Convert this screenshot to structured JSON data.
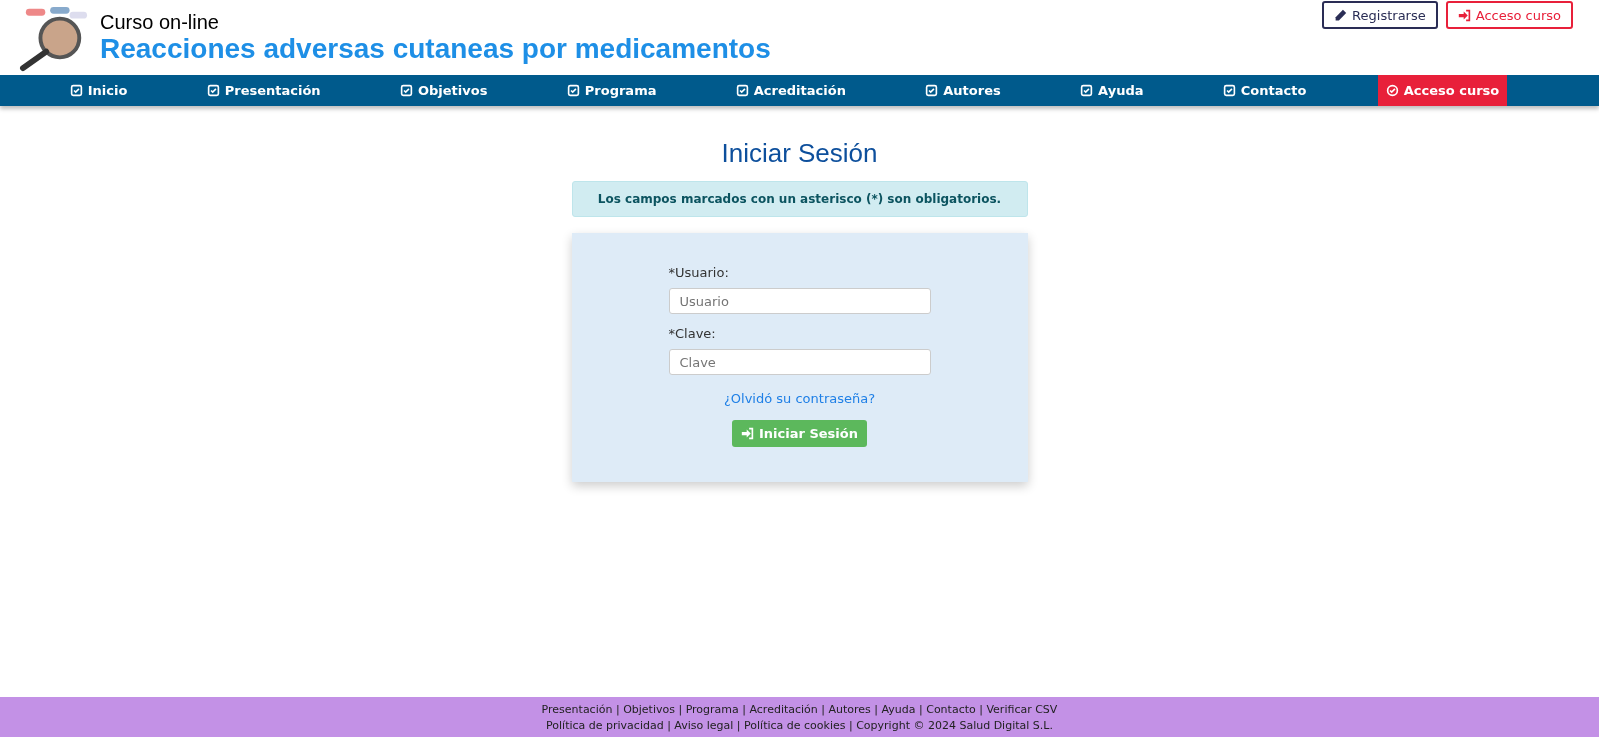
{
  "header": {
    "subtitle": "Curso on-line",
    "title": "Reacciones adversas cutaneas por medicamentos",
    "buttons": [
      {
        "label": "Registrarse",
        "kind": "register"
      },
      {
        "label": "Acceso curso",
        "kind": "access"
      }
    ]
  },
  "nav": [
    {
      "label": "Inicio",
      "selected": false
    },
    {
      "label": "Presentación",
      "selected": false
    },
    {
      "label": "Objetivos",
      "selected": false
    },
    {
      "label": "Programa",
      "selected": false
    },
    {
      "label": "Acreditación",
      "selected": false
    },
    {
      "label": "Autores",
      "selected": false
    },
    {
      "label": "Ayuda",
      "selected": false
    },
    {
      "label": "Contacto",
      "selected": false
    },
    {
      "label": "Acceso curso",
      "selected": true
    }
  ],
  "login": {
    "heading": "Iniciar Sesión",
    "notice": "Los campos marcados con un asterisco (*) son obligatorios.",
    "fields": [
      {
        "label": "*Usuario:",
        "placeholder": "Usuario"
      },
      {
        "label": "*Clave:",
        "placeholder": "Clave"
      }
    ],
    "forgot_link": "¿Olvidó su contraseña?",
    "submit": "Iniciar Sesión"
  },
  "footer": {
    "lines": [
      "Presentación | Objetivos | Programa | Acreditación | Autores | Ayuda | Contacto | Verificar CSV",
      "Política de privacidad | Aviso legal | Política de cookies | Copyright © 2024 Salud Digital S.L."
    ]
  }
}
